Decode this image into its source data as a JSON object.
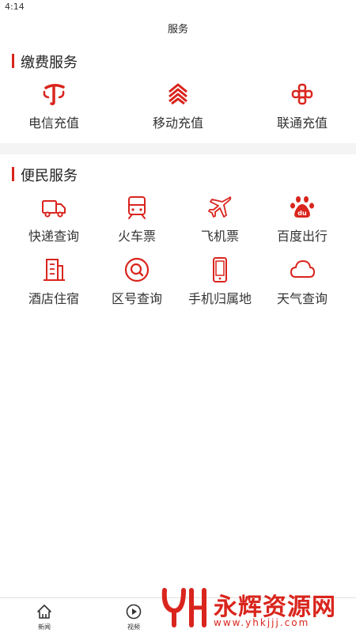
{
  "status_bar": {
    "time": "4:14"
  },
  "nav": {
    "title": "服务"
  },
  "colors": {
    "accent": "#d9251d",
    "background": "#ffffff",
    "band": "#f4f4f4"
  },
  "payment_section": {
    "title": "缴费服务",
    "items": [
      {
        "label": "电信充值",
        "icon": "china-telecom-icon"
      },
      {
        "label": "移动充值",
        "icon": "china-mobile-icon"
      },
      {
        "label": "联通充值",
        "icon": "china-unicom-icon"
      }
    ]
  },
  "convenience_section": {
    "title": "便民服务",
    "items": [
      {
        "label": "快递查询",
        "icon": "truck-icon"
      },
      {
        "label": "火车票",
        "icon": "train-icon"
      },
      {
        "label": "飞机票",
        "icon": "airplane-icon"
      },
      {
        "label": "百度出行",
        "icon": "baidu-paw-icon"
      },
      {
        "label": "酒店住宿",
        "icon": "building-icon"
      },
      {
        "label": "区号查询",
        "icon": "magnifier-icon"
      },
      {
        "label": "手机归属地",
        "icon": "mobile-phone-icon"
      },
      {
        "label": "天气查询",
        "icon": "cloud-icon"
      }
    ]
  },
  "tab_bar": {
    "tabs": [
      {
        "label": "新闻",
        "icon": "home-icon"
      },
      {
        "label": "视频",
        "icon": "play-icon"
      }
    ]
  },
  "watermark": {
    "text": "永辉资源网",
    "url": "www.yhkjjj.com"
  }
}
